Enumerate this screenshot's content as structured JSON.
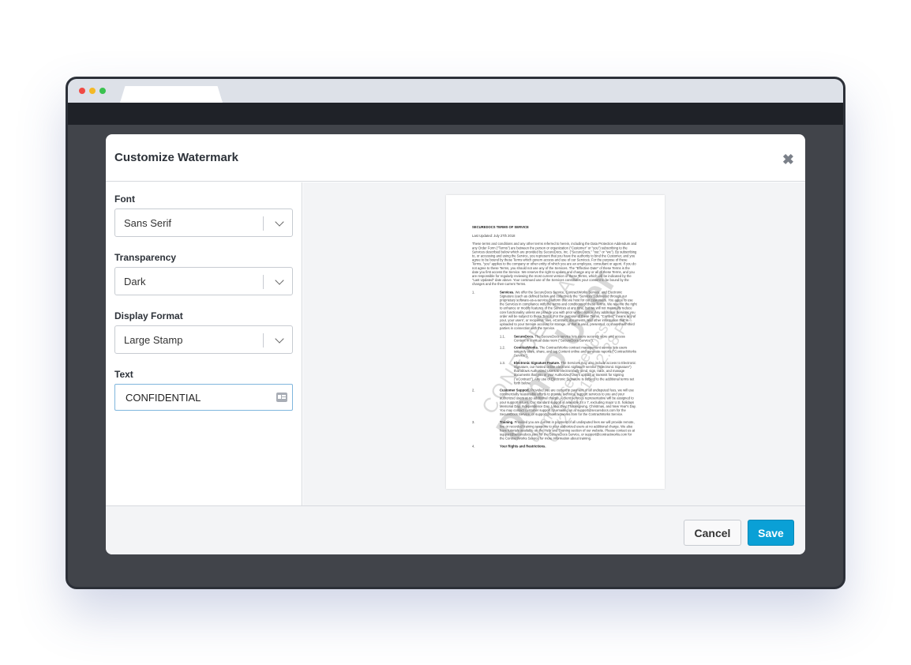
{
  "browser": {
    "dots": [
      "#f04a44",
      "#f4b926",
      "#3ac24f"
    ]
  },
  "modal": {
    "title": "Customize Watermark",
    "close_icon": "close-icon",
    "fields": {
      "font": {
        "label": "Font",
        "value": "Sans Serif"
      },
      "transparency": {
        "label": "Transparency",
        "value": "Dark"
      },
      "display_format": {
        "label": "Display Format",
        "value": "Large Stamp"
      },
      "text": {
        "label": "Text",
        "value": "CONFIDENTIAL",
        "icon": "contact-card-icon"
      }
    },
    "buttons": {
      "cancel": "Cancel",
      "save": "Save"
    },
    "accent": "#0aa0d6"
  },
  "preview": {
    "doc_title": "SECUREDOCS TERMS OF SERVICE",
    "last_updated": "Last Updated: July 27th 2018",
    "intro": "These terms and conditions and any other terms referred to herein, including the Data Protection Addendum and any Order Form (\"Terms\") are between the person or organization (\"Customer\" or \"you\") subscribing to the Services described below which are provided by SecureDocs, Inc. (\"SecureDocs,\" \"our,\" or \"we\"). By subscribing to, or accessing and using the Service, you represent that you have the authority to bind the Customer, and you agree to be bound by these Terms which govern access and use of our Services. For the purpose of these Terms, \"you\" applies to the company or other entity of which you are an employee, consultant or agent. If you do not agree to these Terms, you should not use any of the Services. The \"Effective Date\" of these Terms is the date you first access the Service. We reserve the right to update and change any or all of these Terms, and you are responsible for regularly reviewing the most current version of these Terms, which will be indicated by the \"Last Updated\" date above. Your continued use of the Services constitutes your consent to be bound by the changes and the then-current Terms.",
    "sections": [
      {
        "num": "1.",
        "head": "Services.",
        "body": "We offer the SecureDocs Service, ContractWorks Service, and Electronic Signature (each as defined below and collectively the \"Services\") delivered through our proprietary software-as-a-service platform that we host for our customers. You agree to use the Services in compliance with the terms and conditions of these Terms. We reserve the right to enhance or modify features of the Services at any time, but we will not materially reduce core functionality unless we provide you with prior written notice. Any additional Services you order will be subject to these Terms. For the purpose of these Terms, \"Content\" means any of your, your users', or recipients' files, eContract, documents, and other information that is uploaded to your Service account for storage, or that is used, presented, or shared with third parties in connection with the Service."
      },
      {
        "num": "1.1.",
        "head": "SecureDocs.",
        "body": "The SecureDocs service lets users securely store and access Content in a virtual data room (\"SecureDocs Service\").",
        "sub": true
      },
      {
        "num": "1.2.",
        "head": "ContractWorks.",
        "body": "The ContractWorks contract management service lets users securely store, share, and tag Content online and generate reports (\"ContractWorks Service\").",
        "sub": true
      },
      {
        "num": "1.3.",
        "head": "Electronic Signature Feature.",
        "body": "The Services may also include access to Electronic Signature, our hosted online electronic signature service (\"Electronic Signature\") that allows Authorized Users to electronically send, sign, track, and manage documents that you or your Authorized Users upload or transmit for signing (\"eContract\"). Any use of Electronic Signature is subject to the additional terms set forth below.",
        "sub": true
      },
      {
        "num": "2.",
        "head": "Customer Support.",
        "body": "Provided you are current in payment of all undisputed fees, we will use commercially reasonable efforts to provide technical support services to you and your authorized users at no additional charge. A client services representative will be assigned to your support issues. Our standard support is available 24 x 7, excluding major U.S. holidays Memorial Day, Independence Day, Labor Day, Thanksgiving, Christmas, and New Year's Day. You may contact customer support by emailing us at support@securedocs.com for the SecureDocs Service, or support@contractworks.com for the ContractWorks Service."
      },
      {
        "num": "3.",
        "head": "Training.",
        "body": "Provided you are current in payment of all undisputed fees we will provide remote, live or recorded training sessions to your authorized users at no additional charge. We also have tutorials available on the Help and Training section of our website. Please contact us at support@securedocs.com for the SecureDocs Service, or support@contractworks.com for the ContractWorks Service for more information about training."
      },
      {
        "num": "4.",
        "head": "Your Rights and Restrictions.",
        "body": ""
      }
    ],
    "watermark": {
      "line1": "CONFIDENTIAL",
      "line2": "Demo User",
      "line3": "demo@securedocs.com",
      "line4": "07/27/2018 12:28 PM"
    }
  }
}
